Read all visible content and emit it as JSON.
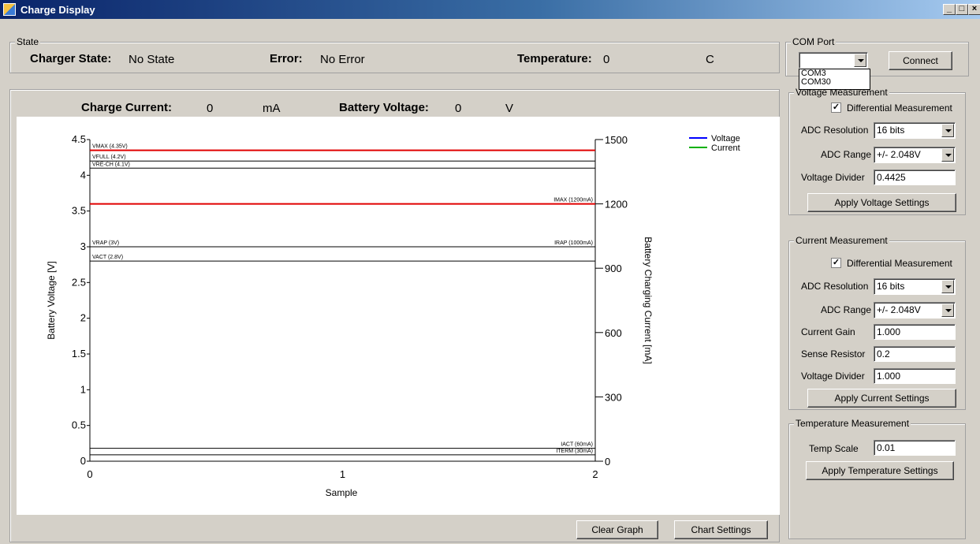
{
  "window": {
    "title": "Charge Display"
  },
  "state": {
    "group_label": "State",
    "charger_state_label": "Charger State:",
    "charger_state_value": "No State",
    "error_label": "Error:",
    "error_value": "No Error",
    "temperature_label": "Temperature:",
    "temperature_value": "0",
    "temperature_unit": "C"
  },
  "readout": {
    "charge_current_label": "Charge Current:",
    "charge_current_value": "0",
    "charge_current_unit": "mA",
    "battery_voltage_label": "Battery Voltage:",
    "battery_voltage_value": "0",
    "battery_voltage_unit": "V"
  },
  "com_port": {
    "group_label": "COM Port",
    "selected": "",
    "connect_label": "Connect",
    "options": [
      "COM3",
      "COM30"
    ]
  },
  "voltage_measurement": {
    "group_label": "Voltage Measurement",
    "differential_label": "Differential Measurement",
    "differential_checked": true,
    "adc_resolution_label": "ADC Resolution",
    "adc_resolution_value": "16 bits",
    "adc_range_label": "ADC Range",
    "adc_range_value": "+/- 2.048V",
    "voltage_divider_label": "Voltage Divider",
    "voltage_divider_value": "0.4425",
    "apply_label": "Apply Voltage Settings"
  },
  "current_measurement": {
    "group_label": "Current Measurement",
    "differential_label": "Differential Measurement",
    "differential_checked": true,
    "adc_resolution_label": "ADC Resolution",
    "adc_resolution_value": "16 bits",
    "adc_range_label": "ADC Range",
    "adc_range_value": "+/- 2.048V",
    "current_gain_label": "Current Gain",
    "current_gain_value": "1.000",
    "sense_resistor_label": "Sense Resistor",
    "sense_resistor_value": "0.2",
    "voltage_divider_label": "Voltage Divider",
    "voltage_divider_value": "1.000",
    "apply_label": "Apply Current Settings"
  },
  "temperature_measurement": {
    "group_label": "Temperature Measurement",
    "temp_scale_label": "Temp Scale",
    "temp_scale_value": "0.01",
    "apply_label": "Apply Temperature Settings"
  },
  "buttons": {
    "clear_graph": "Clear Graph",
    "chart_settings": "Chart Settings"
  },
  "chart_data": {
    "type": "line",
    "xlabel": "Sample",
    "ylabel": "Battery Voltage [V]",
    "y2label": "Battery Charging Current [mA]",
    "xlim": [
      0,
      2
    ],
    "ylim": [
      0,
      4.5
    ],
    "y2lim": [
      0,
      1500
    ],
    "xticks": [
      "0",
      "1",
      "2"
    ],
    "yticks": [
      "0",
      "0.5",
      "1",
      "1.5",
      "2",
      "2.5",
      "3",
      "3.5",
      "4",
      "4.5"
    ],
    "y2ticks": [
      "0",
      "300",
      "600",
      "900",
      "1200",
      "1500"
    ],
    "legend": [
      {
        "name": "Voltage",
        "color": "#0000ff"
      },
      {
        "name": "Current",
        "color": "#00b000"
      }
    ],
    "legend_position": "top-right",
    "series": [
      {
        "name": "Voltage",
        "values": []
      },
      {
        "name": "Current",
        "values": []
      }
    ],
    "threshold_lines": [
      {
        "label": "VMAX (4.35V)",
        "axis": "left",
        "value": 4.35,
        "color": "#e00000",
        "label_side": "left"
      },
      {
        "label": "VFULL (4.2V)",
        "axis": "left",
        "value": 4.2,
        "color": "#000000",
        "label_side": "left"
      },
      {
        "label": "VRE-CH (4.1V)",
        "axis": "left",
        "value": 4.1,
        "color": "#000000",
        "label_side": "left"
      },
      {
        "label": "VRAP (3V)",
        "axis": "left",
        "value": 3.0,
        "color": "#000000",
        "label_side": "left"
      },
      {
        "label": "VACT (2.8V)",
        "axis": "left",
        "value": 2.8,
        "color": "#000000",
        "label_side": "left"
      },
      {
        "label": "IMAX (1200mA)",
        "axis": "right",
        "value": 1200,
        "color": "#e00000",
        "label_side": "right"
      },
      {
        "label": "IRAP (1000mA)",
        "axis": "right",
        "value": 1000,
        "color": "#000000",
        "label_side": "right"
      },
      {
        "label": "IACT (60mA)",
        "axis": "right",
        "value": 60,
        "color": "#000000",
        "label_side": "right"
      },
      {
        "label": "ITERM (30mA)",
        "axis": "right",
        "value": 30,
        "color": "#000000",
        "label_side": "right"
      }
    ]
  }
}
